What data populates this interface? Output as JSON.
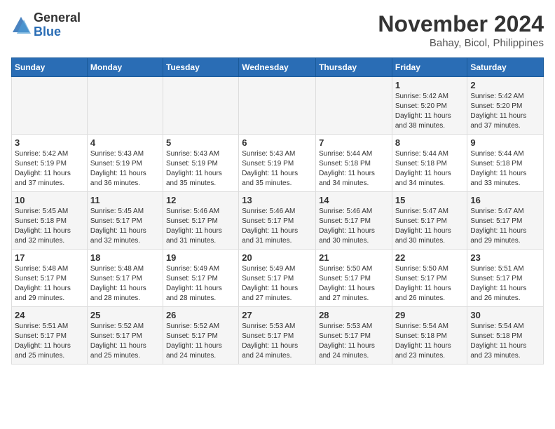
{
  "header": {
    "logo_general": "General",
    "logo_blue": "Blue",
    "month_title": "November 2024",
    "location": "Bahay, Bicol, Philippines"
  },
  "weekdays": [
    "Sunday",
    "Monday",
    "Tuesday",
    "Wednesday",
    "Thursday",
    "Friday",
    "Saturday"
  ],
  "weeks": [
    [
      {
        "day": "",
        "info": ""
      },
      {
        "day": "",
        "info": ""
      },
      {
        "day": "",
        "info": ""
      },
      {
        "day": "",
        "info": ""
      },
      {
        "day": "",
        "info": ""
      },
      {
        "day": "1",
        "info": "Sunrise: 5:42 AM\nSunset: 5:20 PM\nDaylight: 11 hours\nand 38 minutes."
      },
      {
        "day": "2",
        "info": "Sunrise: 5:42 AM\nSunset: 5:20 PM\nDaylight: 11 hours\nand 37 minutes."
      }
    ],
    [
      {
        "day": "3",
        "info": "Sunrise: 5:42 AM\nSunset: 5:19 PM\nDaylight: 11 hours\nand 37 minutes."
      },
      {
        "day": "4",
        "info": "Sunrise: 5:43 AM\nSunset: 5:19 PM\nDaylight: 11 hours\nand 36 minutes."
      },
      {
        "day": "5",
        "info": "Sunrise: 5:43 AM\nSunset: 5:19 PM\nDaylight: 11 hours\nand 35 minutes."
      },
      {
        "day": "6",
        "info": "Sunrise: 5:43 AM\nSunset: 5:19 PM\nDaylight: 11 hours\nand 35 minutes."
      },
      {
        "day": "7",
        "info": "Sunrise: 5:44 AM\nSunset: 5:18 PM\nDaylight: 11 hours\nand 34 minutes."
      },
      {
        "day": "8",
        "info": "Sunrise: 5:44 AM\nSunset: 5:18 PM\nDaylight: 11 hours\nand 34 minutes."
      },
      {
        "day": "9",
        "info": "Sunrise: 5:44 AM\nSunset: 5:18 PM\nDaylight: 11 hours\nand 33 minutes."
      }
    ],
    [
      {
        "day": "10",
        "info": "Sunrise: 5:45 AM\nSunset: 5:18 PM\nDaylight: 11 hours\nand 32 minutes."
      },
      {
        "day": "11",
        "info": "Sunrise: 5:45 AM\nSunset: 5:17 PM\nDaylight: 11 hours\nand 32 minutes."
      },
      {
        "day": "12",
        "info": "Sunrise: 5:46 AM\nSunset: 5:17 PM\nDaylight: 11 hours\nand 31 minutes."
      },
      {
        "day": "13",
        "info": "Sunrise: 5:46 AM\nSunset: 5:17 PM\nDaylight: 11 hours\nand 31 minutes."
      },
      {
        "day": "14",
        "info": "Sunrise: 5:46 AM\nSunset: 5:17 PM\nDaylight: 11 hours\nand 30 minutes."
      },
      {
        "day": "15",
        "info": "Sunrise: 5:47 AM\nSunset: 5:17 PM\nDaylight: 11 hours\nand 30 minutes."
      },
      {
        "day": "16",
        "info": "Sunrise: 5:47 AM\nSunset: 5:17 PM\nDaylight: 11 hours\nand 29 minutes."
      }
    ],
    [
      {
        "day": "17",
        "info": "Sunrise: 5:48 AM\nSunset: 5:17 PM\nDaylight: 11 hours\nand 29 minutes."
      },
      {
        "day": "18",
        "info": "Sunrise: 5:48 AM\nSunset: 5:17 PM\nDaylight: 11 hours\nand 28 minutes."
      },
      {
        "day": "19",
        "info": "Sunrise: 5:49 AM\nSunset: 5:17 PM\nDaylight: 11 hours\nand 28 minutes."
      },
      {
        "day": "20",
        "info": "Sunrise: 5:49 AM\nSunset: 5:17 PM\nDaylight: 11 hours\nand 27 minutes."
      },
      {
        "day": "21",
        "info": "Sunrise: 5:50 AM\nSunset: 5:17 PM\nDaylight: 11 hours\nand 27 minutes."
      },
      {
        "day": "22",
        "info": "Sunrise: 5:50 AM\nSunset: 5:17 PM\nDaylight: 11 hours\nand 26 minutes."
      },
      {
        "day": "23",
        "info": "Sunrise: 5:51 AM\nSunset: 5:17 PM\nDaylight: 11 hours\nand 26 minutes."
      }
    ],
    [
      {
        "day": "24",
        "info": "Sunrise: 5:51 AM\nSunset: 5:17 PM\nDaylight: 11 hours\nand 25 minutes."
      },
      {
        "day": "25",
        "info": "Sunrise: 5:52 AM\nSunset: 5:17 PM\nDaylight: 11 hours\nand 25 minutes."
      },
      {
        "day": "26",
        "info": "Sunrise: 5:52 AM\nSunset: 5:17 PM\nDaylight: 11 hours\nand 24 minutes."
      },
      {
        "day": "27",
        "info": "Sunrise: 5:53 AM\nSunset: 5:17 PM\nDaylight: 11 hours\nand 24 minutes."
      },
      {
        "day": "28",
        "info": "Sunrise: 5:53 AM\nSunset: 5:17 PM\nDaylight: 11 hours\nand 24 minutes."
      },
      {
        "day": "29",
        "info": "Sunrise: 5:54 AM\nSunset: 5:18 PM\nDaylight: 11 hours\nand 23 minutes."
      },
      {
        "day": "30",
        "info": "Sunrise: 5:54 AM\nSunset: 5:18 PM\nDaylight: 11 hours\nand 23 minutes."
      }
    ]
  ]
}
